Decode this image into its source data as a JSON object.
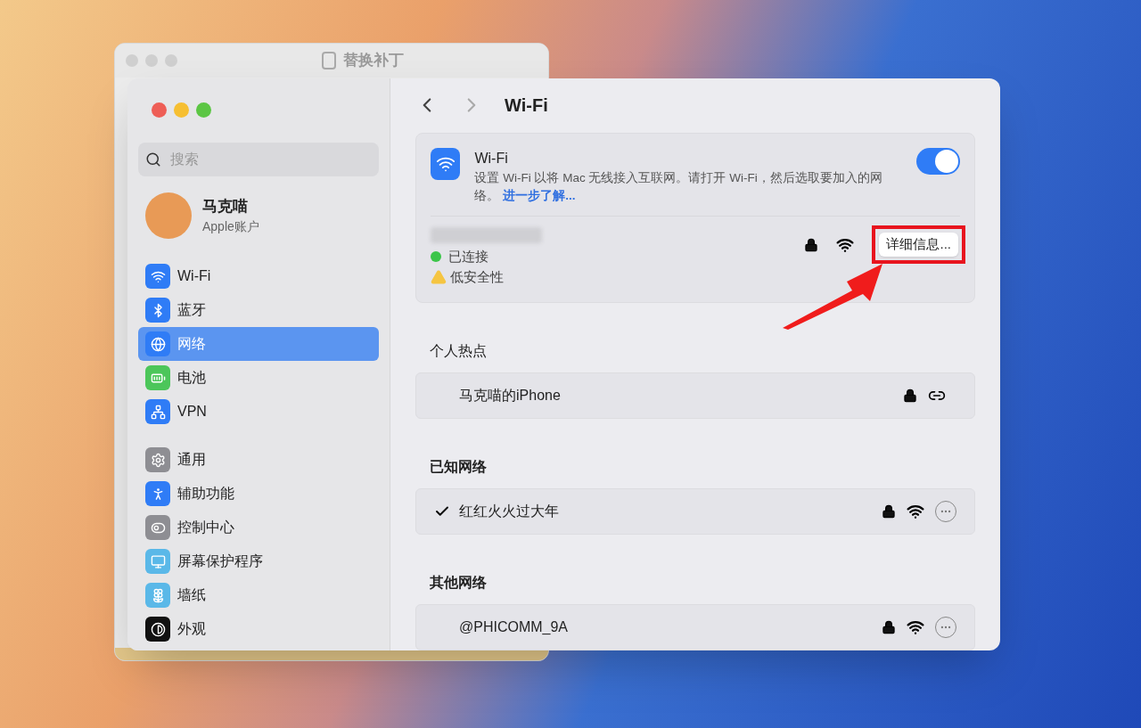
{
  "background_window": {
    "title": "替换补丁"
  },
  "window": {
    "title": "Wi-Fi"
  },
  "sidebar": {
    "search": {
      "placeholder": "搜索"
    },
    "account": {
      "name": "马克喵",
      "subtitle": "Apple账户"
    },
    "groups": [
      [
        {
          "label": "Wi-Fi",
          "kind": "wifi",
          "selected": false
        },
        {
          "label": "蓝牙",
          "kind": "bluetooth",
          "selected": false
        },
        {
          "label": "网络",
          "kind": "network",
          "selected": true
        },
        {
          "label": "电池",
          "kind": "battery",
          "selected": false
        },
        {
          "label": "VPN",
          "kind": "vpn",
          "selected": false
        }
      ],
      [
        {
          "label": "通用",
          "kind": "general",
          "selected": false
        },
        {
          "label": "辅助功能",
          "kind": "accessibility",
          "selected": false
        },
        {
          "label": "控制中心",
          "kind": "control",
          "selected": false
        },
        {
          "label": "屏幕保护程序",
          "kind": "screensaver",
          "selected": false
        },
        {
          "label": "墙纸",
          "kind": "wallpaper",
          "selected": false
        },
        {
          "label": "外观",
          "kind": "appearance",
          "selected": false
        }
      ]
    ]
  },
  "wifi_card": {
    "title": "Wi-Fi",
    "description": "设置 Wi-Fi 以将 Mac 无线接入互联网。请打开 Wi-Fi，然后选取要加入的网络。",
    "link": "进一步了解...",
    "on": true
  },
  "current_network": {
    "connected": true,
    "status": "已连接",
    "security_warning": "低安全性",
    "details_button": "详细信息...",
    "highlighted": true
  },
  "sections": [
    {
      "title": "个人热点",
      "bold": false,
      "networks": [
        {
          "name": "马克喵的iPhone",
          "kind": "hotspot",
          "connected": false
        }
      ]
    },
    {
      "title": "已知网络",
      "bold": true,
      "networks": [
        {
          "name": "红红火火过大年",
          "kind": "wifi",
          "connected": true
        }
      ]
    },
    {
      "title": "其他网络",
      "bold": true,
      "networks": [
        {
          "name": "@PHICOMM_9A",
          "kind": "wifi",
          "connected": false
        }
      ]
    }
  ]
}
